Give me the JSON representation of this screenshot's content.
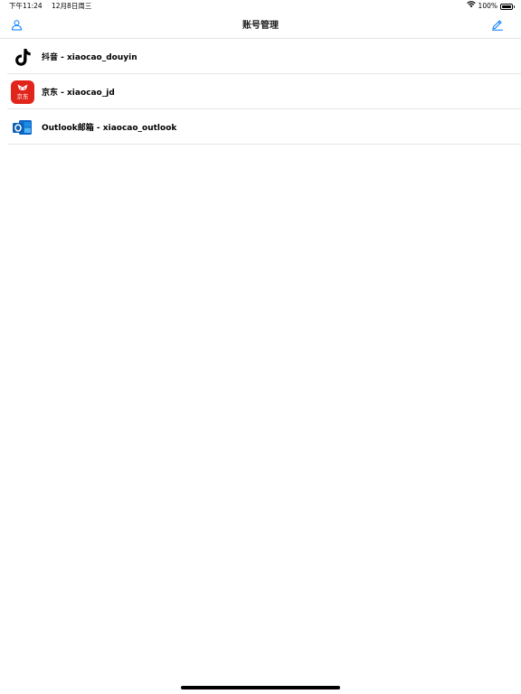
{
  "status_bar": {
    "time": "下午11:24",
    "date": "12月8日周三",
    "battery_text": "100%",
    "battery_level_percent": 100
  },
  "nav": {
    "title": "账号管理",
    "left_icon": "person-icon",
    "right_icon": "edit-pencil-icon",
    "accent_color": "#007aff"
  },
  "accounts": [
    {
      "app": "抖音",
      "username": "xiaocao_douyin",
      "label": "抖音 - xiaocao_douyin",
      "icon": "tiktok-icon"
    },
    {
      "app": "京东",
      "username": "xiaocao_jd",
      "label": "京东 - xiaocao_jd",
      "icon": "jd-icon",
      "icon_text": "京东"
    },
    {
      "app": "Outlook邮箱",
      "username": "xiaocao_outlook",
      "label": "Outlook邮箱 - xiaocao_outlook",
      "icon": "outlook-icon"
    }
  ]
}
